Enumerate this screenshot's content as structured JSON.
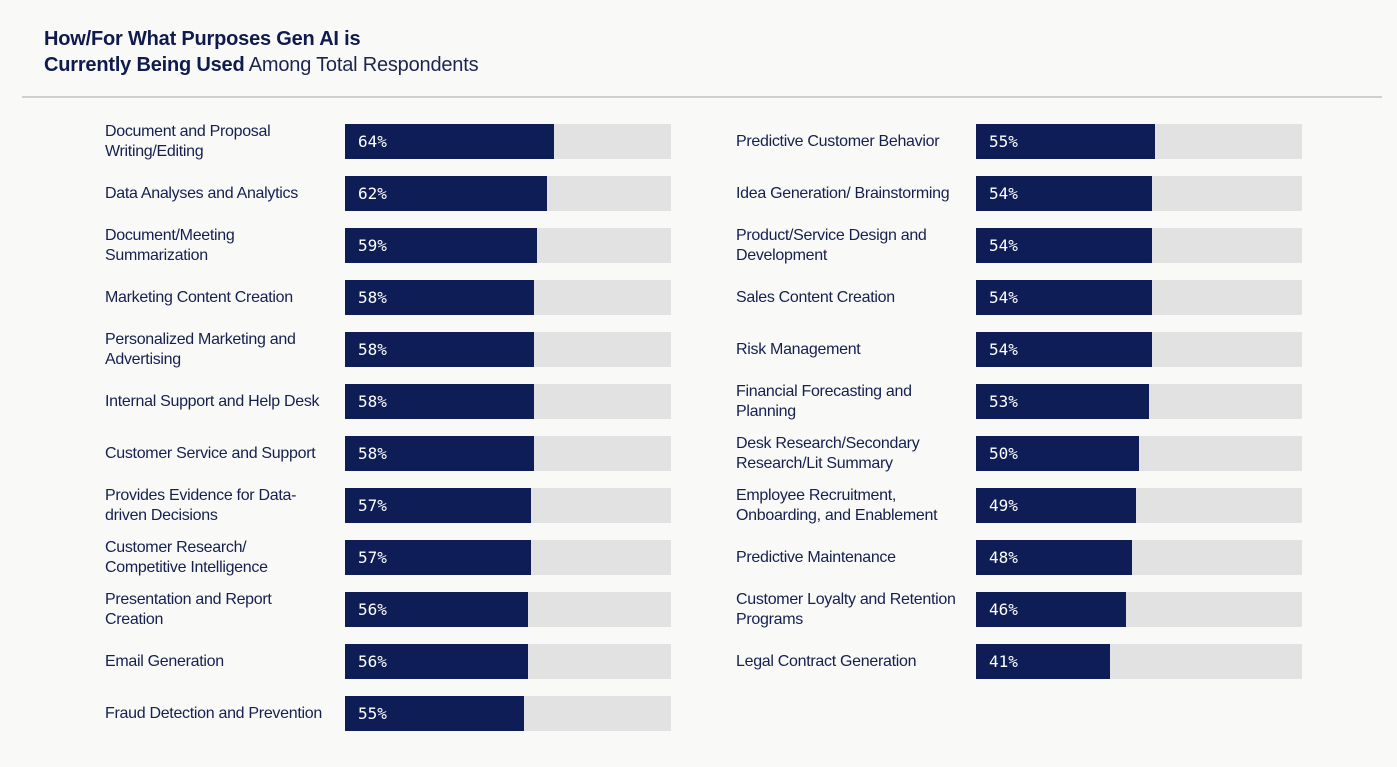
{
  "title": {
    "bold_line1": "How/For What Purposes Gen AI is",
    "bold_line2": "Currently Being Used",
    "light_suffix": "Among Total Respondents"
  },
  "colors": {
    "bar": "#0f1d57",
    "track": "#e2e2e2",
    "text": "#15204f",
    "background": "#f9f9f8"
  },
  "chart_data": {
    "type": "bar",
    "orientation": "horizontal",
    "title": "How/For What Purposes Gen AI is Currently Being Used Among Total Respondents",
    "unit": "%",
    "xlim": [
      0,
      100
    ],
    "grid": false,
    "legend": "none",
    "categories": [
      "Document and Proposal Writing/Editing",
      "Data Analyses and Analytics",
      "Document/Meeting Summarization",
      "Marketing Content Creation",
      "Personalized Marketing and Advertising",
      "Internal Support and Help Desk",
      "Customer Service and Support",
      "Provides Evidence for Data-driven Decisions",
      "Customer Research/ Competitive Intelligence",
      "Presentation and Report Creation",
      "Email Generation",
      "Fraud Detection and Prevention",
      "Predictive Customer Behavior",
      "Idea Generation/ Brainstorming",
      "Product/Service Design and Development",
      "Sales Content Creation",
      "Risk Management",
      "Financial Forecasting and Planning",
      "Desk Research/Secondary Research/Lit Summary",
      "Employee Recruitment, Onboarding, and Enablement",
      "Predictive Maintenance",
      "Customer Loyalty and Retention Programs",
      "Legal Contract Generation"
    ],
    "values": [
      64,
      62,
      59,
      58,
      58,
      58,
      58,
      57,
      57,
      56,
      56,
      55,
      55,
      54,
      54,
      54,
      54,
      53,
      50,
      49,
      48,
      46,
      41
    ],
    "columns": {
      "left": [
        {
          "label": "Document and Proposal Writing/Editing",
          "value": 64,
          "value_label": "64%"
        },
        {
          "label": "Data Analyses and Analytics",
          "value": 62,
          "value_label": "62%"
        },
        {
          "label": "Document/Meeting Summarization",
          "value": 59,
          "value_label": "59%"
        },
        {
          "label": "Marketing Content Creation",
          "value": 58,
          "value_label": "58%"
        },
        {
          "label": "Personalized Marketing and Advertising",
          "value": 58,
          "value_label": "58%"
        },
        {
          "label": "Internal Support and Help Desk",
          "value": 58,
          "value_label": "58%"
        },
        {
          "label": "Customer Service and Support",
          "value": 58,
          "value_label": "58%"
        },
        {
          "label": "Provides Evidence for Data-driven Decisions",
          "value": 57,
          "value_label": "57%"
        },
        {
          "label": "Customer Research/ Competitive Intelligence",
          "value": 57,
          "value_label": "57%"
        },
        {
          "label": "Presentation and Report Creation",
          "value": 56,
          "value_label": "56%"
        },
        {
          "label": "Email Generation",
          "value": 56,
          "value_label": "56%"
        },
        {
          "label": "Fraud Detection and Prevention",
          "value": 55,
          "value_label": "55%"
        }
      ],
      "right": [
        {
          "label": "Predictive Customer Behavior",
          "value": 55,
          "value_label": "55%"
        },
        {
          "label": "Idea Generation/ Brainstorming",
          "value": 54,
          "value_label": "54%"
        },
        {
          "label": "Product/Service Design and Development",
          "value": 54,
          "value_label": "54%"
        },
        {
          "label": "Sales Content Creation",
          "value": 54,
          "value_label": "54%"
        },
        {
          "label": "Risk Management",
          "value": 54,
          "value_label": "54%"
        },
        {
          "label": "Financial Forecasting and Planning",
          "value": 53,
          "value_label": "53%"
        },
        {
          "label": "Desk Research/Secondary Research/Lit Summary",
          "value": 50,
          "value_label": "50%"
        },
        {
          "label": "Employee Recruitment, Onboarding, and Enablement",
          "value": 49,
          "value_label": "49%"
        },
        {
          "label": "Predictive Maintenance",
          "value": 48,
          "value_label": "48%"
        },
        {
          "label": "Customer Loyalty and Retention Programs",
          "value": 46,
          "value_label": "46%"
        },
        {
          "label": "Legal Contract Generation",
          "value": 41,
          "value_label": "41%"
        }
      ]
    }
  }
}
